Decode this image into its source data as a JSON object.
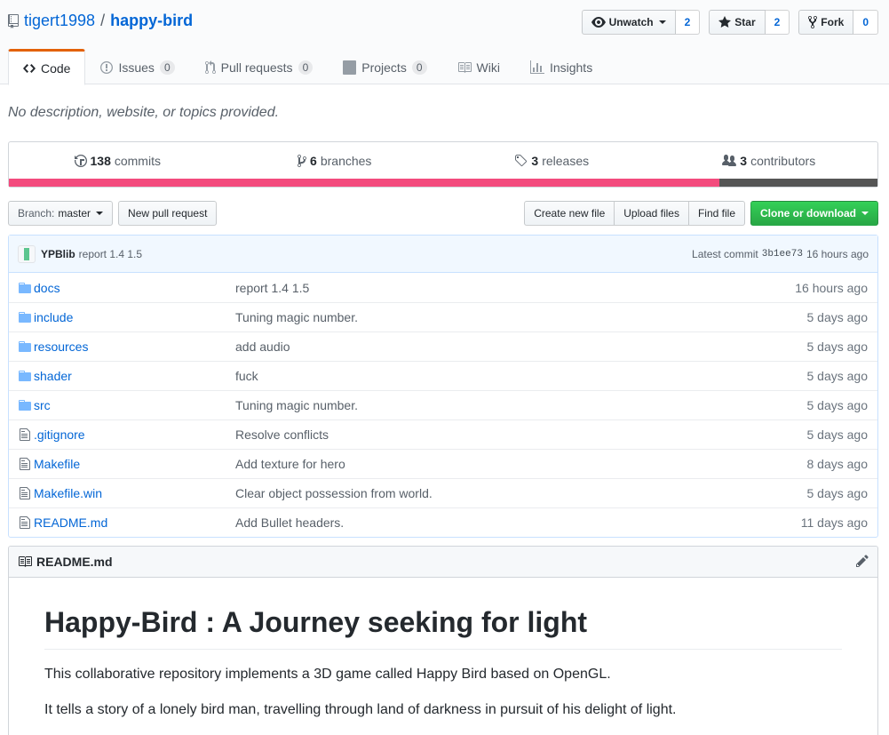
{
  "repo": {
    "owner": "tigert1998",
    "separator": "/",
    "name": "happy-bird"
  },
  "actions": {
    "watch": {
      "label": "Unwatch",
      "count": "2"
    },
    "star": {
      "label": "Star",
      "count": "2"
    },
    "fork": {
      "label": "Fork",
      "count": "0"
    }
  },
  "tabs": [
    {
      "label": "Code",
      "count": null
    },
    {
      "label": "Issues",
      "count": "0"
    },
    {
      "label": "Pull requests",
      "count": "0"
    },
    {
      "label": "Projects",
      "count": "0"
    },
    {
      "label": "Wiki",
      "count": null
    },
    {
      "label": "Insights",
      "count": null
    }
  ],
  "description": "No description, website, or topics provided.",
  "summary": {
    "commits": {
      "num": "138",
      "label": "commits"
    },
    "branches": {
      "num": "6",
      "label": "branches"
    },
    "releases": {
      "num": "3",
      "label": "releases"
    },
    "contributors": {
      "num": "3",
      "label": "contributors"
    },
    "languages": [
      {
        "share": 0.818,
        "color": "#f34b7d"
      },
      {
        "share": 0.182,
        "color": "#555555"
      }
    ]
  },
  "filenav": {
    "branch_prefix": "Branch:",
    "branch": "master",
    "new_pr": "New pull request",
    "create_file": "Create new file",
    "upload": "Upload files",
    "find": "Find file",
    "clone": "Clone or download"
  },
  "commit_tease": {
    "author": "YPBlib",
    "message": "report 1.4 1.5",
    "prefix": "Latest commit",
    "sha": "3b1ee73",
    "age": "16 hours ago"
  },
  "files": [
    {
      "type": "dir",
      "name": "docs",
      "message": "report 1.4 1.5",
      "age": "16 hours ago"
    },
    {
      "type": "dir",
      "name": "include",
      "message": "Tuning magic number.",
      "age": "5 days ago"
    },
    {
      "type": "dir",
      "name": "resources",
      "message": "add audio",
      "age": "5 days ago"
    },
    {
      "type": "dir",
      "name": "shader",
      "message": "fuck",
      "age": "5 days ago"
    },
    {
      "type": "dir",
      "name": "src",
      "message": "Tuning magic number.",
      "age": "5 days ago"
    },
    {
      "type": "file",
      "name": ".gitignore",
      "message": "Resolve conflicts",
      "age": "5 days ago"
    },
    {
      "type": "file",
      "name": "Makefile",
      "message": "Add texture for hero",
      "age": "8 days ago"
    },
    {
      "type": "file",
      "name": "Makefile.win",
      "message": "Clear object possession from world.",
      "age": "5 days ago"
    },
    {
      "type": "file",
      "name": "README.md",
      "message": "Add Bullet headers.",
      "age": "11 days ago"
    }
  ],
  "readme": {
    "filename": "README.md",
    "heading": "Happy-Bird : A Journey seeking for light",
    "paragraphs": [
      "This collaborative repository implements a 3D game called Happy Bird based on OpenGL.",
      "It tells a story of a lonely bird man, travelling through land of darkness in pursuit of his delight of light."
    ]
  }
}
